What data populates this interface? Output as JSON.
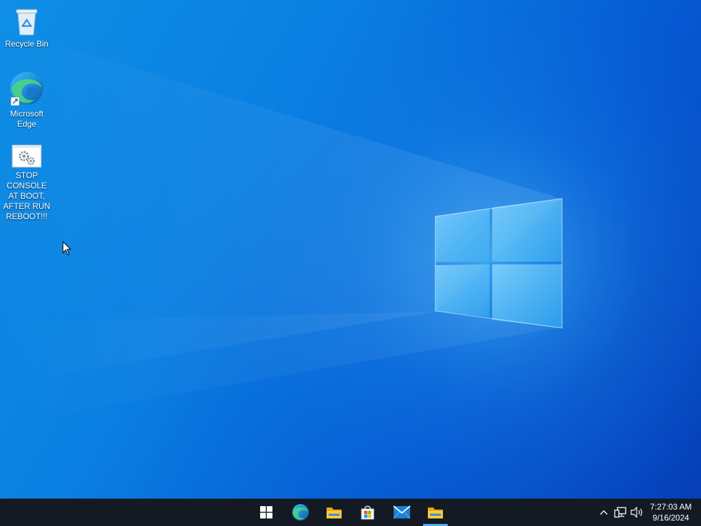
{
  "desktop": {
    "icons": [
      {
        "label": "Recycle Bin",
        "icon": "recycle-bin-icon"
      },
      {
        "label": "Microsoft Edge",
        "icon": "edge-icon"
      },
      {
        "label": "STOP CONSOLE AT BOOT, AFTER RUN REBOOT!!!",
        "icon": "settings-gears-icon"
      }
    ],
    "wallpaper": "windows-logo-wallpaper"
  },
  "taskbar": {
    "apps": [
      {
        "name": "Start",
        "icon": "windows-start-icon"
      },
      {
        "name": "Microsoft Edge",
        "icon": "edge-icon"
      },
      {
        "name": "File Explorer",
        "icon": "file-explorer-icon"
      },
      {
        "name": "Microsoft Store",
        "icon": "store-icon"
      },
      {
        "name": "Mail",
        "icon": "mail-icon"
      },
      {
        "name": "File Explorer",
        "icon": "file-explorer-icon",
        "active": true
      }
    ],
    "tray": {
      "icons": [
        "chevron-up-icon",
        "network-icon",
        "volume-icon"
      ],
      "time": "7:27:03 AM",
      "date": "9/16/2024"
    }
  },
  "colors": {
    "wallpaper_light": "#0f8fe6",
    "wallpaper_dark": "#063fb8",
    "taskbar": "#141a24",
    "active_indicator": "#5aa9f0"
  }
}
